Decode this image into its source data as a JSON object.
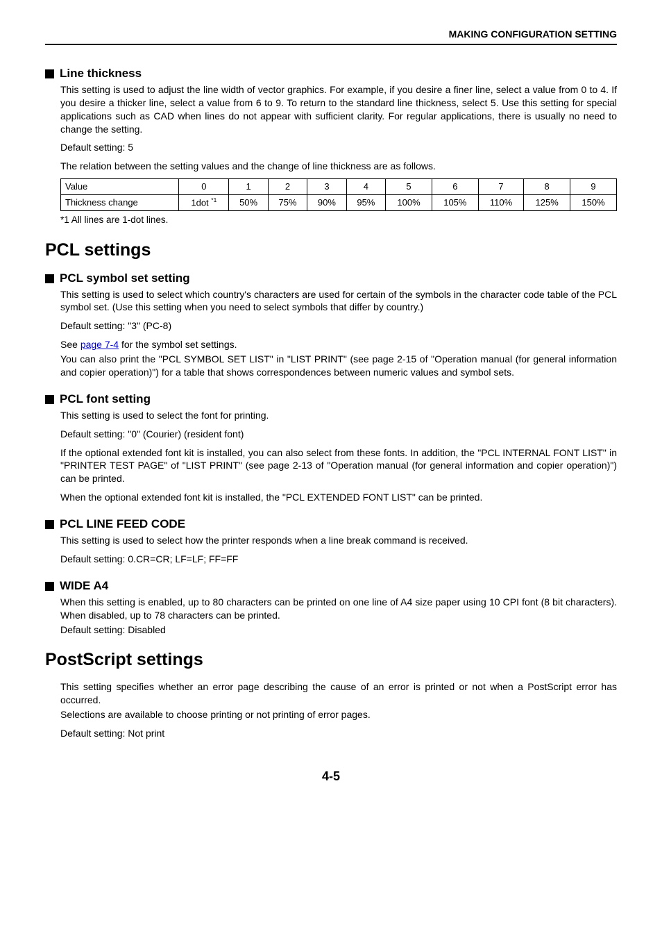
{
  "header": {
    "title": "MAKING CONFIGURATION SETTING"
  },
  "line_thickness": {
    "heading": "Line thickness",
    "body": "This setting is used to adjust the line width of vector graphics. For example, if you desire a finer line, select a value from 0 to 4. If you desire a thicker line, select a value from 6 to 9. To return to the standard line thickness, select 5. Use this setting for special applications such as CAD when lines do not appear with sufficient clarity. For regular applications, there is usually no need to change the setting.",
    "default": "Default setting: 5",
    "relation": "The relation between the setting values and the change of line thickness are as follows.",
    "table": {
      "row1_label": "Value",
      "row2_label": "Thickness change",
      "values": [
        "0",
        "1",
        "2",
        "3",
        "4",
        "5",
        "6",
        "7",
        "8",
        "9"
      ],
      "changes_first": "1dot ",
      "changes_first_sup": "*1",
      "changes": [
        "50%",
        "75%",
        "90%",
        "95%",
        "100%",
        "105%",
        "110%",
        "125%",
        "150%"
      ]
    },
    "footnote": "*1 All lines are 1-dot lines."
  },
  "pcl": {
    "heading": "PCL settings",
    "symbol": {
      "heading": "PCL symbol set setting",
      "body": "This setting is used to select which country's characters are used for certain of the symbols in the character code table of the PCL symbol set. (Use this setting when you need to select symbols that differ by country.)",
      "default": "Default setting: \"3\" (PC-8)",
      "see_prefix": "See ",
      "see_link": "page 7-4",
      "see_suffix": " for the symbol set settings.",
      "body2": "You can also print the \"PCL SYMBOL SET LIST\" in \"LIST PRINT\" (see page 2-15 of \"Operation manual (for general information and copier operation)\") for a table that shows correspondences between numeric values and symbol sets."
    },
    "font": {
      "heading": "PCL font setting",
      "body": "This setting is used to select the font for printing.",
      "default": "Default setting: \"0\" (Courier) (resident font)",
      "body2": "If the optional extended font kit is installed, you can also select from these fonts. In addition, the \"PCL INTERNAL FONT LIST\" in \"PRINTER TEST PAGE\" of \"LIST PRINT\" (see page 2-13 of \"Operation manual (for general information and copier operation)\") can be printed.",
      "body3": "When the optional extended font kit is installed, the \"PCL EXTENDED FONT LIST\" can be printed."
    },
    "lf": {
      "heading": "PCL LINE FEED CODE",
      "body": "This setting is used to select how the printer responds when a line break command is received.",
      "default": "Default setting: 0.CR=CR; LF=LF; FF=FF"
    },
    "wide": {
      "heading": "WIDE A4",
      "body": "When this setting is enabled, up to 80 characters can be printed on one line of A4 size paper using 10 CPI font (8 bit characters). When disabled, up to 78 characters can be printed.",
      "default": "Default setting: Disabled"
    }
  },
  "postscript": {
    "heading": "PostScript settings",
    "body": "This setting specifies whether an error page describing the cause of an error is printed or not when a PostScript error has occurred.",
    "body2": "Selections are available to choose printing or not printing of error pages.",
    "default": "Default setting: Not print"
  },
  "page_number": "4-5",
  "chart_data": {
    "type": "table",
    "title": "Line thickness — setting value vs. thickness change",
    "columns": [
      "Value",
      "Thickness change"
    ],
    "rows": [
      [
        "0",
        "1dot *1"
      ],
      [
        "1",
        "50%"
      ],
      [
        "2",
        "75%"
      ],
      [
        "3",
        "90%"
      ],
      [
        "4",
        "95%"
      ],
      [
        "5",
        "100%"
      ],
      [
        "6",
        "105%"
      ],
      [
        "7",
        "110%"
      ],
      [
        "8",
        "125%"
      ],
      [
        "9",
        "150%"
      ]
    ],
    "footnote": "*1 All lines are 1-dot lines."
  }
}
